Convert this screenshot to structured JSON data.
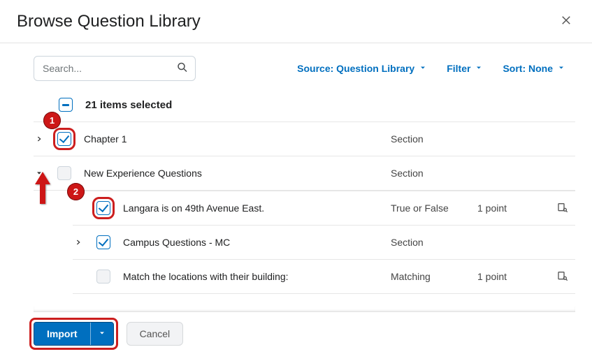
{
  "dialog": {
    "title": "Browse Question Library"
  },
  "search": {
    "placeholder": "Search..."
  },
  "filters": {
    "source": "Source: Question Library",
    "filter": "Filter",
    "sort": "Sort: None"
  },
  "selection": {
    "summary": "21 items selected"
  },
  "rows": {
    "chapter1": {
      "title": "Chapter 1",
      "type": "Section"
    },
    "newexp": {
      "title": "New Experience Questions",
      "type": "Section"
    },
    "langara": {
      "title": "Langara is on 49th Avenue East.",
      "type": "True or False",
      "points": "1 point"
    },
    "campus": {
      "title": "Campus Questions - MC",
      "type": "Section"
    },
    "match": {
      "title": "Match the locations with their building:",
      "type": "Matching",
      "points": "1 point"
    }
  },
  "footer": {
    "import": "Import",
    "cancel": "Cancel"
  },
  "annotations": {
    "b1": "1",
    "b2": "2"
  }
}
